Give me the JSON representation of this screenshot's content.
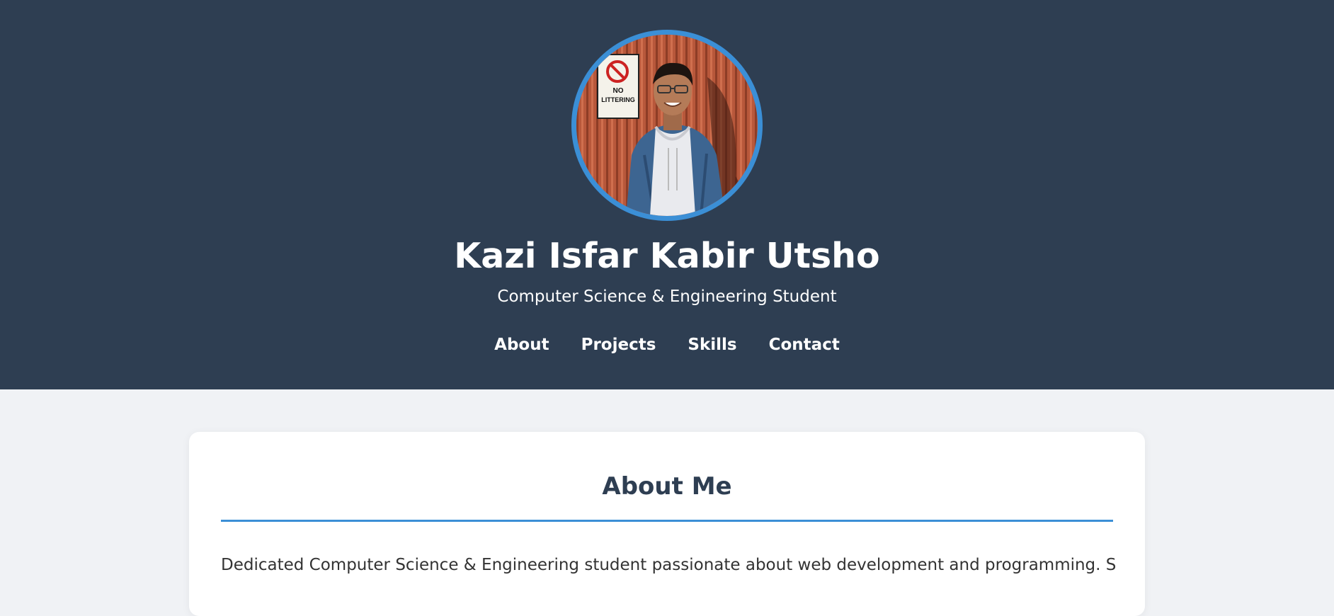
{
  "header": {
    "name": "Kazi Isfar Kabir Utsho",
    "subtitle": "Computer Science & Engineering Student",
    "avatar_sign": [
      "NO",
      "LITTERING"
    ],
    "nav": [
      {
        "label": "About"
      },
      {
        "label": "Projects"
      },
      {
        "label": "Skills"
      },
      {
        "label": "Contact"
      }
    ]
  },
  "about": {
    "title": "About Me",
    "text": "Dedicated Computer Science & Engineering student passionate about web development and programming. Seeking"
  },
  "colors": {
    "hero_bg": "#2e3e52",
    "accent": "#3b8fd6",
    "page_bg": "#f0f2f5",
    "card_bg": "#ffffff",
    "title_text": "#2e3e52"
  }
}
